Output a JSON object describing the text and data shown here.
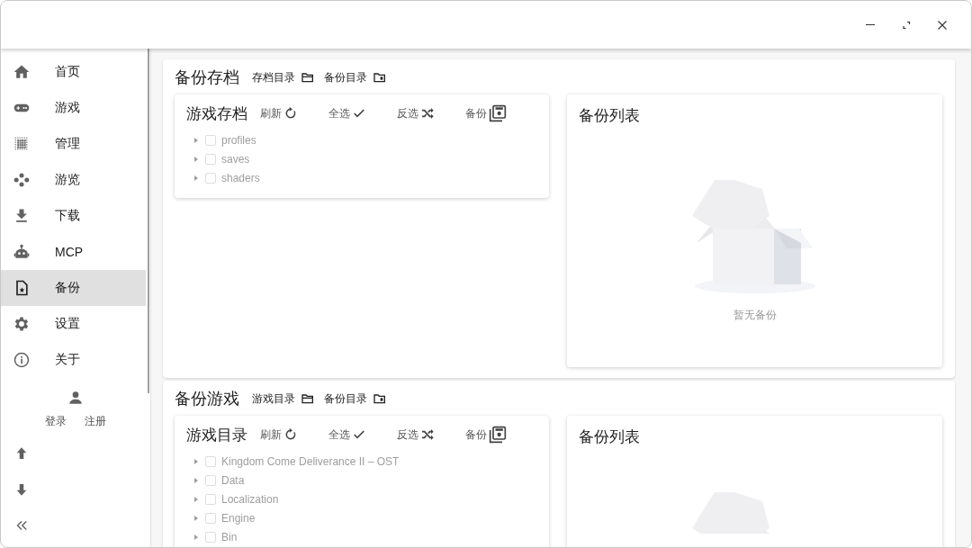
{
  "window": {
    "controls": [
      {
        "kind": "minimize"
      },
      {
        "kind": "maximize"
      },
      {
        "kind": "close"
      }
    ]
  },
  "sidebar": {
    "items": [
      {
        "label": "首页",
        "kind": "home",
        "selected": false
      },
      {
        "label": "游戏",
        "kind": "gamepad",
        "selected": false
      },
      {
        "label": "管理",
        "kind": "grid",
        "selected": false
      },
      {
        "label": "游览",
        "kind": "dots",
        "selected": false
      },
      {
        "label": "下载",
        "kind": "download",
        "selected": false
      },
      {
        "label": "MCP",
        "kind": "robot",
        "selected": false
      },
      {
        "label": "备份",
        "kind": "file",
        "selected": true
      },
      {
        "label": "设置",
        "kind": "gear",
        "selected": false
      },
      {
        "label": "关于",
        "kind": "info",
        "selected": false
      }
    ],
    "account": {
      "login": "登录",
      "register": "注册"
    },
    "bottom_buttons": [
      {
        "kind": "up"
      },
      {
        "kind": "down"
      },
      {
        "kind": "collapse"
      }
    ]
  },
  "sections": [
    {
      "title": "备份存档",
      "links": [
        {
          "label": "存档目录",
          "kind": "open"
        },
        {
          "label": "备份目录",
          "kind": "backup"
        }
      ],
      "panel": {
        "title": "游戏存档",
        "actions": [
          {
            "label": "刷新",
            "kind": "refresh"
          },
          {
            "label": "全选",
            "kind": "select-all"
          },
          {
            "label": "反选",
            "kind": "invert"
          },
          {
            "label": "备份",
            "kind": "backup"
          }
        ],
        "tree": [
          {
            "label": "profiles",
            "checked": false,
            "expanded": false
          },
          {
            "label": "saves",
            "checked": false,
            "expanded": false
          },
          {
            "label": "shaders",
            "checked": false,
            "expanded": false
          }
        ]
      },
      "list": {
        "title": "备份列表",
        "empty_text": "暂无备份"
      }
    },
    {
      "title": "备份游戏",
      "links": [
        {
          "label": "游戏目录",
          "kind": "open"
        },
        {
          "label": "备份目录",
          "kind": "backup"
        }
      ],
      "panel": {
        "title": "游戏目录",
        "actions": [
          {
            "label": "刷新",
            "kind": "refresh"
          },
          {
            "label": "全选",
            "kind": "select-all"
          },
          {
            "label": "反选",
            "kind": "invert"
          },
          {
            "label": "备份",
            "kind": "backup"
          }
        ],
        "tree": [
          {
            "label": "Kingdom Come Deliverance II – OST",
            "checked": false,
            "expanded": false
          },
          {
            "label": "Data",
            "checked": false,
            "expanded": false
          },
          {
            "label": "Localization",
            "checked": false,
            "expanded": false
          },
          {
            "label": "Engine",
            "checked": false,
            "expanded": false
          },
          {
            "label": "Bin",
            "checked": false,
            "expanded": false
          }
        ]
      },
      "list": {
        "title": "备份列表"
      }
    }
  ]
}
